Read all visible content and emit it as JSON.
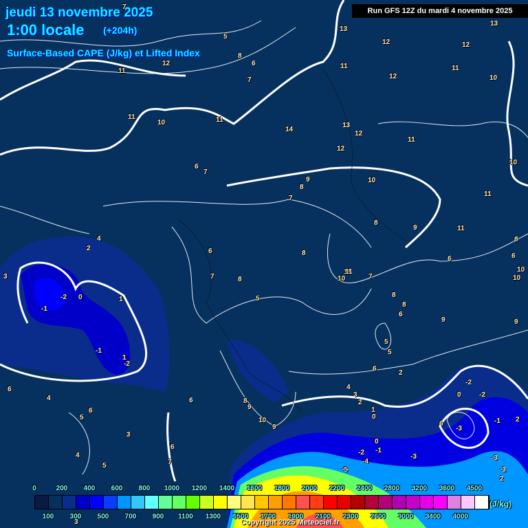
{
  "header": {
    "date": "jeudi 13 novembre 2025",
    "time": "1:00 locale",
    "lead": "(+204h)",
    "product": "Surface-Based CAPE (J/kg) et Lifted Index",
    "run": "Run GFS 12Z du mardi 4 novembre 2025"
  },
  "colors": {
    "background": "#06315f",
    "contour": "#ffffff",
    "title": "#00ffff"
  },
  "contour_labels": [
    "7",
    "5",
    "8",
    "6",
    "7",
    "13",
    "12",
    "12",
    "11",
    "11",
    "12",
    "13",
    "10",
    "11",
    "10",
    "12",
    "11",
    "11",
    "11",
    "14",
    "13",
    "12",
    "12",
    "11",
    "10",
    "6",
    "7",
    "8",
    "9",
    "7",
    "10",
    "11",
    "9",
    "11",
    "8",
    "8",
    "6",
    "4",
    "2",
    "6",
    "7",
    "8",
    "8",
    "5",
    "11",
    "10",
    "7",
    "8",
    "6",
    "9",
    "9",
    "10",
    "10",
    "8",
    "6",
    "5",
    "5",
    "6",
    "2",
    "3",
    "-1",
    "-2",
    "0",
    "1",
    "-1",
    "-2",
    "1",
    "6",
    "4",
    "6",
    "5",
    "3",
    "4",
    "5",
    "6",
    "7",
    "6",
    "8",
    "9",
    "10",
    "9",
    "4",
    "3",
    "2",
    "1",
    "0",
    "0",
    "-1",
    "-2",
    "-3",
    "-4",
    "-5",
    "-3",
    "-2",
    "-2",
    "0",
    "2",
    "6",
    "-3",
    "-1",
    "2",
    "-3",
    "3"
  ],
  "colorbar": {
    "unit": "(J/kg)",
    "top_labels": [
      "0",
      "200",
      "400",
      "600",
      "800",
      "1000",
      "1200",
      "1400",
      "1600",
      "1800",
      "2000",
      "2200",
      "2400",
      "2800",
      "3200",
      "3600",
      "4500"
    ],
    "bottom_labels": [
      "100",
      "300",
      "500",
      "700",
      "900",
      "1100",
      "1300",
      "1500",
      "1700",
      "1900",
      "2100",
      "2300",
      "2600",
      "3000",
      "3400",
      "4000"
    ],
    "colors": [
      "#0a1a42",
      "#06315f",
      "#0a2d8c",
      "#0000c8",
      "#0000ff",
      "#0a3cff",
      "#0096ff",
      "#32c8ff",
      "#64ffff",
      "#64ff96",
      "#64ff64",
      "#64ff00",
      "#c8ff1e",
      "#ffff00",
      "#ffff80",
      "#ffe650",
      "#ffc800",
      "#ffa000",
      "#ff7800",
      "#ff5050",
      "#ff3c14",
      "#ff0000",
      "#e60000",
      "#b40000",
      "#b4003c",
      "#b40078",
      "#b400b4",
      "#c800c8",
      "#e600e6",
      "#ff00ff",
      "#e080e0",
      "#ffc8ff",
      "#ffffff"
    ]
  },
  "footer": {
    "copyright": "Copyright 2025 Meteociel.fr"
  }
}
